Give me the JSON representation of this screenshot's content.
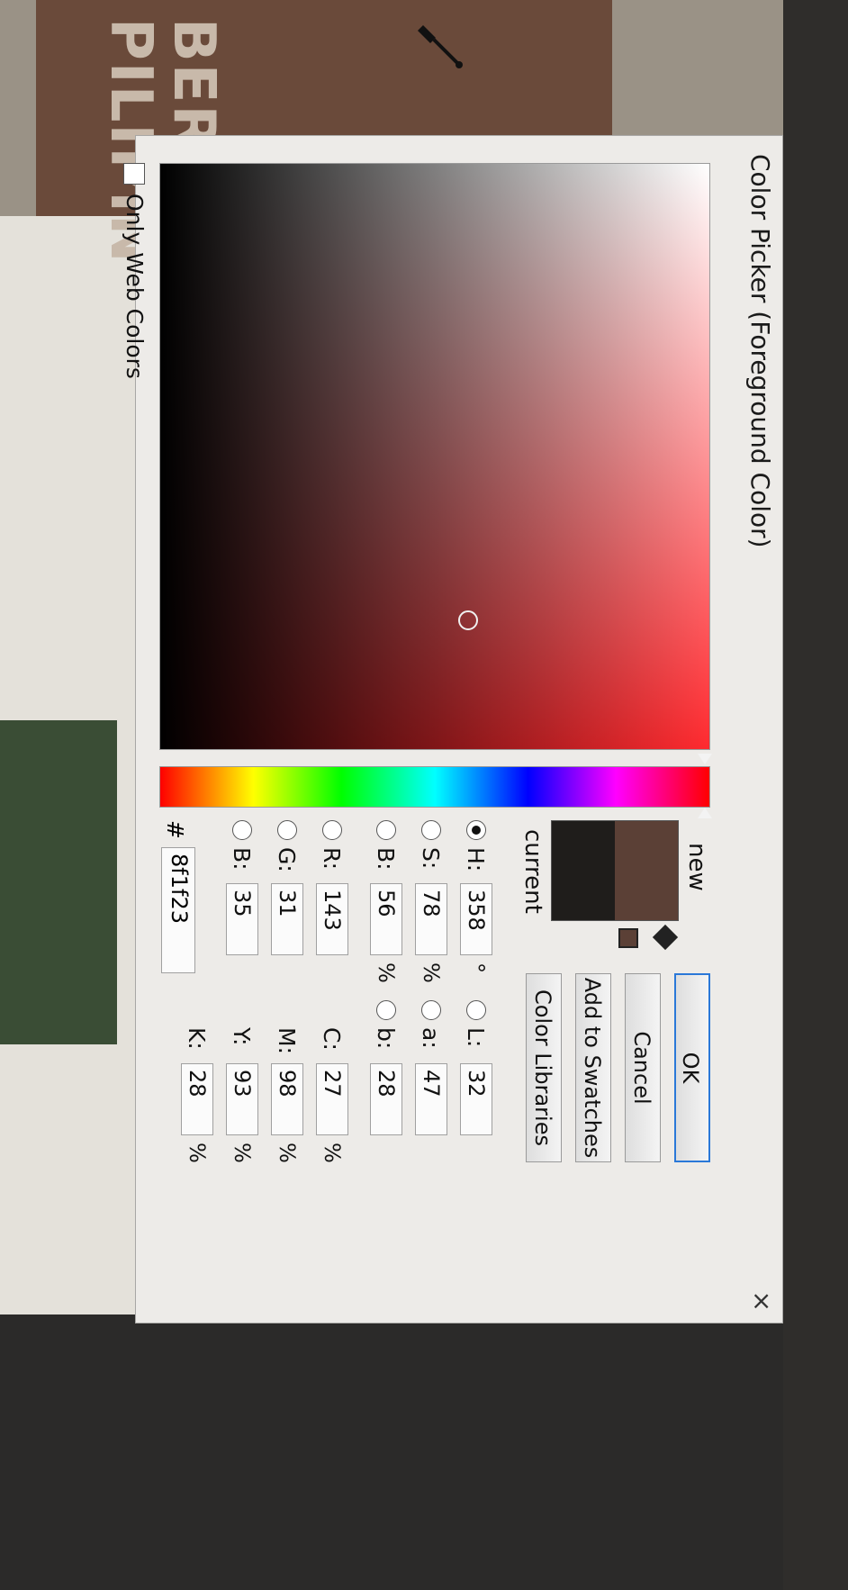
{
  "background": {
    "sticker_text": "BERSID\nPILIPIN"
  },
  "dialog": {
    "title": "Color Picker (Foreground Color)",
    "close_glyph": "×",
    "buttons": {
      "ok": "OK",
      "cancel": "Cancel",
      "add_to_swatches": "Add to Swatches",
      "color_libraries": "Color Libraries"
    },
    "swatches": {
      "new_label": "new",
      "current_label": "current",
      "new_color": "#5b4036",
      "current_color": "#1f1d1b"
    },
    "hsb": [
      {
        "label": "H:",
        "value": "358",
        "unit": "°",
        "selected": true
      },
      {
        "label": "S:",
        "value": "78",
        "unit": "%",
        "selected": false
      },
      {
        "label": "B:",
        "value": "56",
        "unit": "%",
        "selected": false
      }
    ],
    "rgb": [
      {
        "label": "R:",
        "value": "143",
        "selected": false
      },
      {
        "label": "G:",
        "value": "31",
        "selected": false
      },
      {
        "label": "B:",
        "value": "35",
        "selected": false
      }
    ],
    "lab": [
      {
        "label": "L:",
        "value": "32",
        "selected": false
      },
      {
        "label": "a:",
        "value": "47",
        "selected": false
      },
      {
        "label": "b:",
        "value": "28",
        "selected": false
      }
    ],
    "cmyk": [
      {
        "label": "C:",
        "value": "27",
        "unit": "%"
      },
      {
        "label": "M:",
        "value": "98",
        "unit": "%"
      },
      {
        "label": "Y:",
        "value": "93",
        "unit": "%"
      },
      {
        "label": "K:",
        "value": "28",
        "unit": "%"
      }
    ],
    "hex_prefix": "#",
    "hex": "8f1f23",
    "only_web_colors": {
      "label": "Only Web Colors",
      "checked": false
    },
    "hue_level": 0.99,
    "field_selection": {
      "saturation": 0.78,
      "brightness": 0.56
    }
  }
}
